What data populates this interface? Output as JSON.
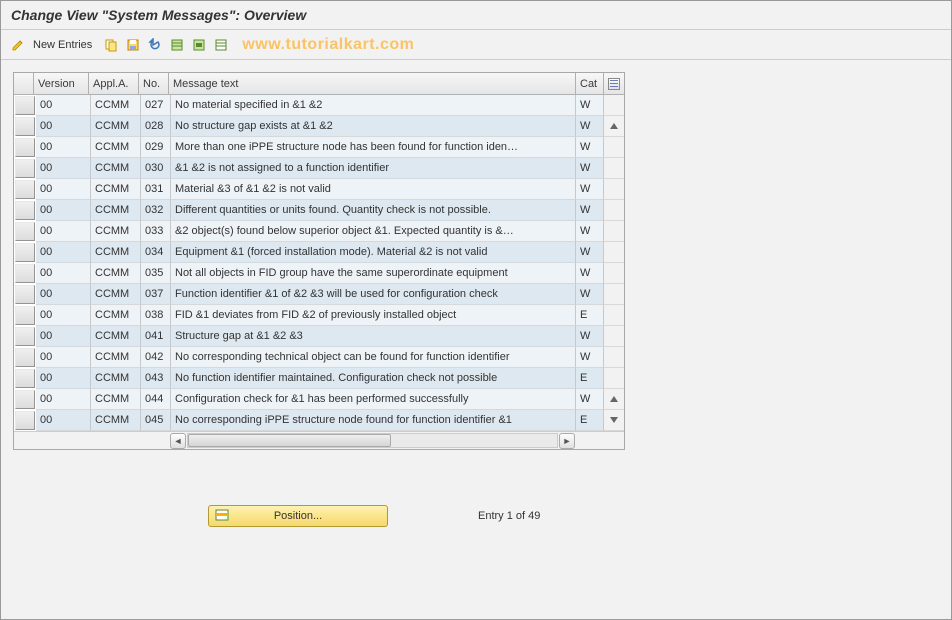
{
  "title": "Change View \"System Messages\": Overview",
  "toolbar": {
    "new_entries": "New Entries"
  },
  "watermark": "www.tutorialkart.com",
  "columns": {
    "version": "Version",
    "appl": "Appl.A.",
    "no": "No.",
    "msg": "Message text",
    "cat": "Cat"
  },
  "rows": [
    {
      "version": "00",
      "appl": "CCMM",
      "no": "027",
      "msg": "No material specified in &1 &2",
      "cat": "W"
    },
    {
      "version": "00",
      "appl": "CCMM",
      "no": "028",
      "msg": "No structure gap exists at &1 &2",
      "cat": "W"
    },
    {
      "version": "00",
      "appl": "CCMM",
      "no": "029",
      "msg": "More than one iPPE structure node has been found for function iden…",
      "cat": "W"
    },
    {
      "version": "00",
      "appl": "CCMM",
      "no": "030",
      "msg": "&1 &2 is not assigned to a function identifier",
      "cat": "W"
    },
    {
      "version": "00",
      "appl": "CCMM",
      "no": "031",
      "msg": "Material &3 of &1 &2 is not valid",
      "cat": "W"
    },
    {
      "version": "00",
      "appl": "CCMM",
      "no": "032",
      "msg": "Different quantities or units found. Quantity check is not possible.",
      "cat": "W"
    },
    {
      "version": "00",
      "appl": "CCMM",
      "no": "033",
      "msg": "&2 object(s) found below superior object &1. Expected quantity is &…",
      "cat": "W"
    },
    {
      "version": "00",
      "appl": "CCMM",
      "no": "034",
      "msg": "Equipment &1 (forced installation mode). Material &2 is not valid",
      "cat": "W"
    },
    {
      "version": "00",
      "appl": "CCMM",
      "no": "035",
      "msg": "Not all objects in FID group have the same superordinate equipment",
      "cat": "W"
    },
    {
      "version": "00",
      "appl": "CCMM",
      "no": "037",
      "msg": "Function identifier &1 of &2 &3 will be used for configuration check",
      "cat": "W"
    },
    {
      "version": "00",
      "appl": "CCMM",
      "no": "038",
      "msg": "FID &1 deviates from FID &2 of previously installed object",
      "cat": "E"
    },
    {
      "version": "00",
      "appl": "CCMM",
      "no": "041",
      "msg": "Structure gap at &1 &2 &3",
      "cat": "W"
    },
    {
      "version": "00",
      "appl": "CCMM",
      "no": "042",
      "msg": "No corresponding technical object can be found for function identifier",
      "cat": "W"
    },
    {
      "version": "00",
      "appl": "CCMM",
      "no": "043",
      "msg": "No function identifier maintained. Configuration check not possible",
      "cat": "E"
    },
    {
      "version": "00",
      "appl": "CCMM",
      "no": "044",
      "msg": "Configuration check for &1 has been performed successfully",
      "cat": "W"
    },
    {
      "version": "00",
      "appl": "CCMM",
      "no": "045",
      "msg": "No corresponding iPPE structure node found for function identifier &1",
      "cat": "E"
    }
  ],
  "footer": {
    "position": "Position...",
    "entry": "Entry 1 of 49"
  }
}
